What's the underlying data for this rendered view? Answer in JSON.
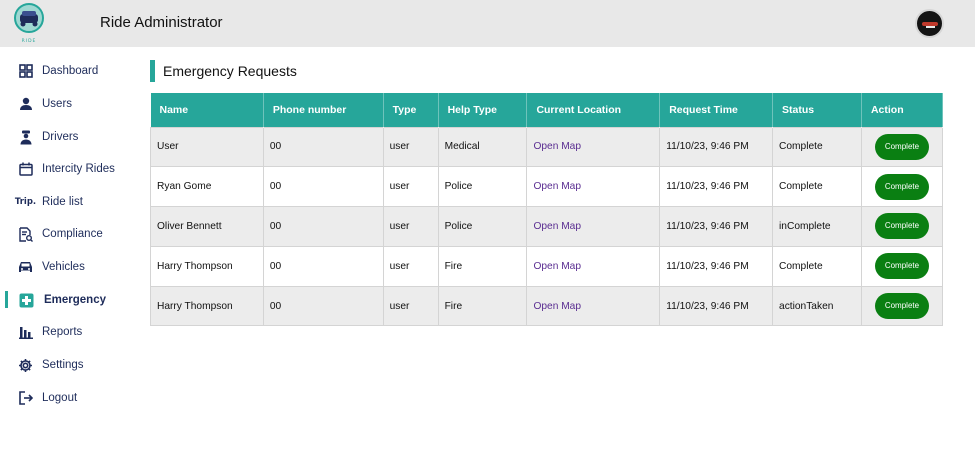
{
  "header": {
    "logo_icon": "ride-car-logo-icon",
    "title": "Ride Administrator",
    "avatar_icon": "profile-avatar-icon"
  },
  "sidebar": {
    "items": [
      {
        "label": "Dashboard",
        "icon": "dashboard-grid-icon"
      },
      {
        "label": "Users",
        "icon": "user-icon"
      },
      {
        "label": "Drivers",
        "icon": "driver-icon"
      },
      {
        "label": "Intercity Rides",
        "icon": "calendar-icon"
      },
      {
        "label": "Ride list",
        "icon": "trip-text-icon",
        "icon_text": "Trip."
      },
      {
        "label": "Compliance",
        "icon": "document-search-icon"
      },
      {
        "label": "Vehicles",
        "icon": "car-icon"
      },
      {
        "label": "Emergency",
        "icon": "medical-cross-icon",
        "active": true
      },
      {
        "label": "Reports",
        "icon": "bar-chart-icon"
      },
      {
        "label": "Settings",
        "icon": "gear-icon"
      },
      {
        "label": "Logout",
        "icon": "logout-icon"
      }
    ]
  },
  "main": {
    "section_title": "Emergency Requests",
    "columns": [
      "Name",
      "Phone number",
      "Type",
      "Help Type",
      "Current Location",
      "Request Time",
      "Status",
      "Action"
    ],
    "rows": [
      {
        "name": "User",
        "phone": "00",
        "type": "user",
        "help_type": "Medical",
        "location": "Open Map",
        "time": "11/10/23, 9:46 PM",
        "status": "Complete",
        "action": "Complete"
      },
      {
        "name": "Ryan Gome",
        "phone": "00",
        "type": "user",
        "help_type": "Police",
        "location": "Open Map",
        "time": "11/10/23, 9:46 PM",
        "status": "Complete",
        "action": "Complete"
      },
      {
        "name": "Oliver Bennett",
        "phone": "00",
        "type": "user",
        "help_type": "Police",
        "location": "Open Map",
        "time": "11/10/23, 9:46 PM",
        "status": "inComplete",
        "action": "Complete"
      },
      {
        "name": "Harry Thompson",
        "phone": "00",
        "type": "user",
        "help_type": "Fire",
        "location": "Open Map",
        "time": "11/10/23, 9:46 PM",
        "status": "Complete",
        "action": "Complete"
      },
      {
        "name": "Harry Thompson",
        "phone": "00",
        "type": "user",
        "help_type": "Fire",
        "location": "Open Map",
        "time": "11/10/23, 9:46 PM",
        "status": "actionTaken",
        "action": "Complete"
      }
    ]
  },
  "colors": {
    "accent": "#26a69a",
    "button": "#0a7f12",
    "link": "#5a2d91",
    "nav_text": "#1e2c5a"
  }
}
